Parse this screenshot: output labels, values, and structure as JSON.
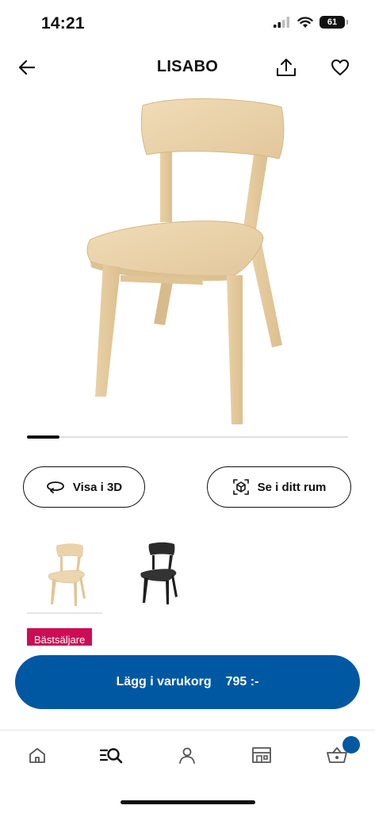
{
  "status_bar": {
    "time": "14:21",
    "battery": "61"
  },
  "header": {
    "title": "LISABO",
    "back_icon": "arrow-left-icon",
    "share_icon": "share-icon",
    "favorite_icon": "heart-icon"
  },
  "gallery": {
    "image_position": 0.1
  },
  "actions": {
    "view_3d_label": "Visa i 3D",
    "view_in_room_label": "Se i ditt rum"
  },
  "variants": [
    {
      "name": "ash",
      "color": "#e8d2aa",
      "selected": true
    },
    {
      "name": "black",
      "color": "#2a2a2a",
      "selected": false
    }
  ],
  "badge": {
    "label": "Bästsäljare",
    "color": "#cc0d55"
  },
  "cart": {
    "label": "Lägg i varukorg",
    "price": "795 :-",
    "color": "#0058a3"
  },
  "tabbar": {
    "items": [
      "home-icon",
      "search-icon",
      "profile-icon",
      "store-icon",
      "cart-icon"
    ],
    "active": "search-icon"
  }
}
